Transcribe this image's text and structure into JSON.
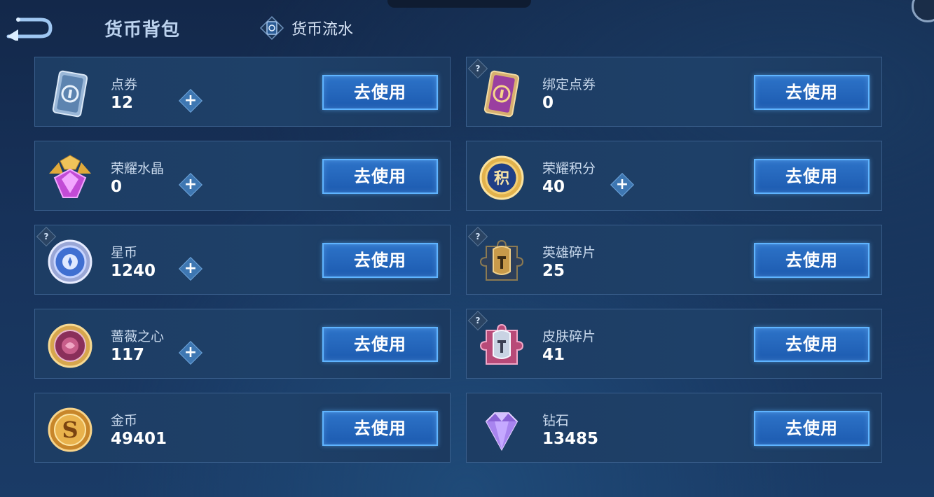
{
  "header": {
    "title": "货币背包",
    "flow_tab_label": "货币流水"
  },
  "colors": {
    "button_fill": "#2164b8",
    "button_border": "#5fb4ff",
    "card_bg": "#1e4068",
    "plus_fill": "#3e77b2"
  },
  "currencies": [
    {
      "name": "点券",
      "amount": "12",
      "use_label": "去使用",
      "icon": "voucher-card-icon"
    },
    {
      "name": "绑定点券",
      "amount": "0",
      "use_label": "去使用",
      "icon": "bound-voucher-card-icon",
      "help": "?"
    },
    {
      "name": "荣耀水晶",
      "amount": "0",
      "use_label": "去使用",
      "icon": "glory-crystal-icon"
    },
    {
      "name": "荣耀积分",
      "amount": "40",
      "use_label": "去使用",
      "icon": "glory-points-coin-icon",
      "coin_text": "积"
    },
    {
      "name": "星币",
      "amount": "1240",
      "use_label": "去使用",
      "icon": "star-coin-icon",
      "help": "?"
    },
    {
      "name": "英雄碎片",
      "amount": "25",
      "use_label": "去使用",
      "icon": "hero-fragment-icon",
      "help": "?"
    },
    {
      "name": "蔷薇之心",
      "amount": "117",
      "use_label": "去使用",
      "icon": "rose-heart-icon"
    },
    {
      "name": "皮肤碎片",
      "amount": "41",
      "use_label": "去使用",
      "icon": "skin-fragment-icon",
      "help": "?"
    },
    {
      "name": "金币",
      "amount": "49401",
      "use_label": "去使用",
      "icon": "gold-coin-icon",
      "coin_text": "S"
    },
    {
      "name": "钻石",
      "amount": "13485",
      "use_label": "去使用",
      "icon": "diamond-icon"
    }
  ],
  "plus_symbol": "+"
}
